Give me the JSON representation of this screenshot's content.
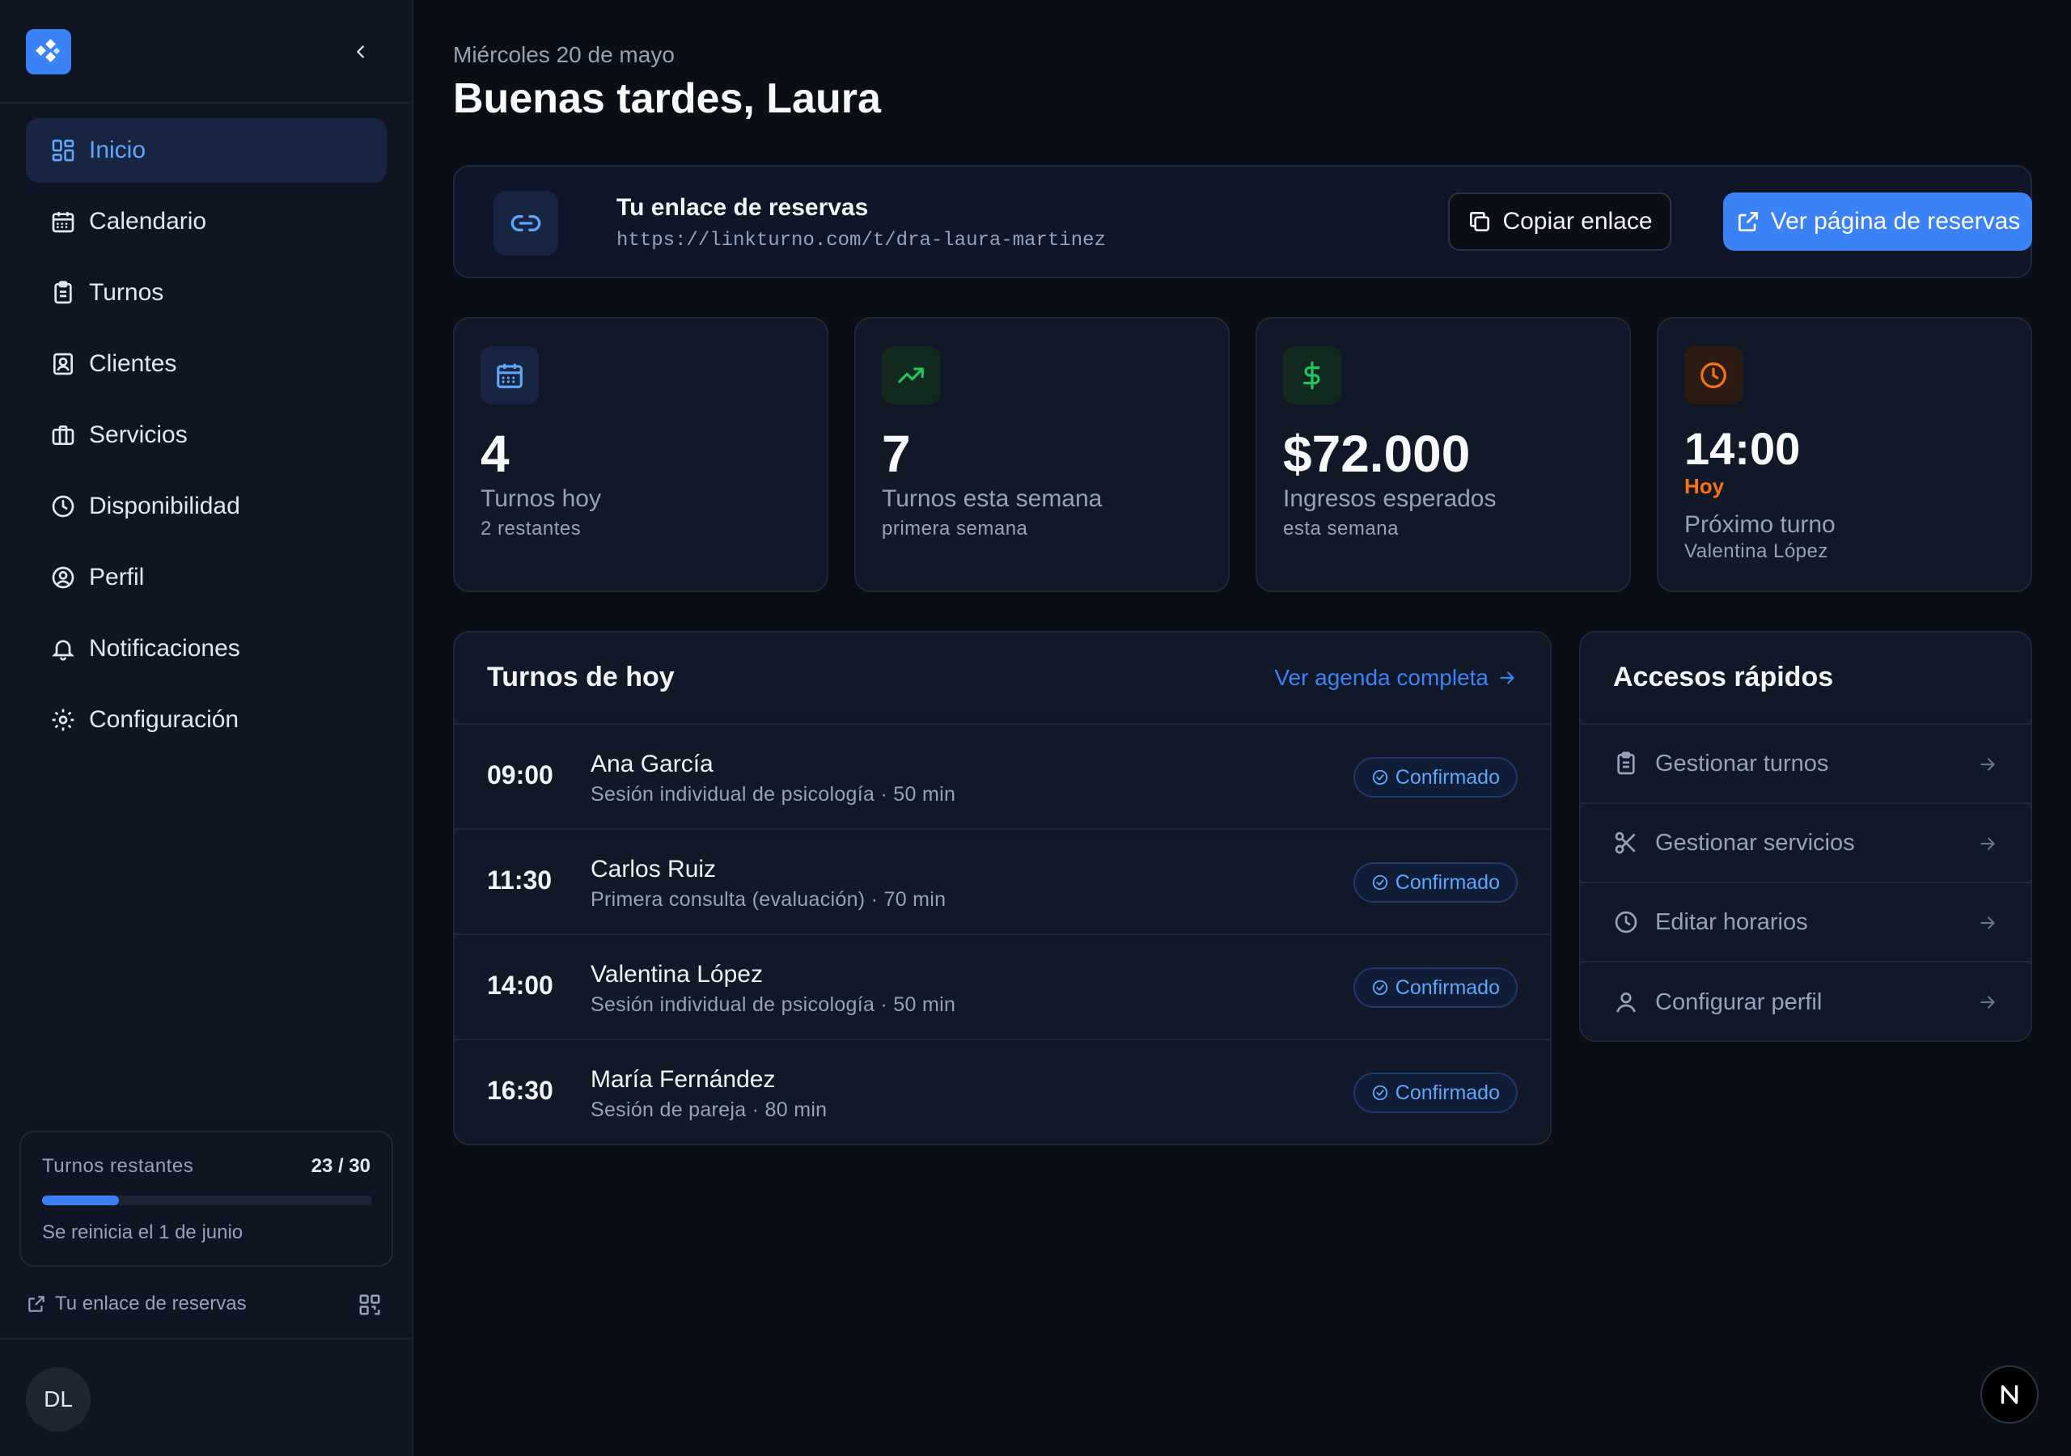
{
  "sidebar": {
    "logo_icon": "app-logo-icon",
    "collapse_icon": "chevron-left-icon",
    "nav": [
      {
        "label": "Inicio",
        "icon": "dashboard-grid-icon",
        "active": true
      },
      {
        "label": "Calendario",
        "icon": "calendar-icon"
      },
      {
        "label": "Turnos",
        "icon": "clipboard-icon"
      },
      {
        "label": "Clientes",
        "icon": "contact-card-icon"
      },
      {
        "label": "Servicios",
        "icon": "briefcase-icon"
      },
      {
        "label": "Disponibilidad",
        "icon": "clock-icon"
      },
      {
        "label": "Perfil",
        "icon": "user-circle-icon"
      },
      {
        "label": "Notificaciones",
        "icon": "bell-icon"
      },
      {
        "label": "Configuración",
        "icon": "gear-icon"
      }
    ],
    "quota": {
      "label": "Turnos restantes",
      "count": "23 / 30",
      "used_fraction": 0.233,
      "reset": "Se reinicia el 1 de junio"
    },
    "booking_link": "Tu enlace de reservas",
    "avatar": "DL"
  },
  "main": {
    "date": "Miércoles 20 de mayo",
    "greeting": "Buenas tardes, Laura",
    "booking": {
      "title": "Tu enlace de reservas",
      "url": "https://linkturno.com/t/dra-laura-martinez",
      "copy_label": "Copiar enlace",
      "view_label": "Ver página de reservas"
    },
    "stats": [
      {
        "icon": "calendar-icon",
        "value": "4",
        "label": "Turnos hoy",
        "sub": "2 restantes"
      },
      {
        "icon": "trending-up-icon",
        "value": "7",
        "label": "Turnos esta semana",
        "sub": "primera semana"
      },
      {
        "icon": "dollar-icon",
        "value": "$72.000",
        "label": "Ingresos esperados",
        "sub": "esta semana"
      },
      {
        "icon": "clock-icon",
        "value": "14:00",
        "tag": "Hoy",
        "label": "Próximo turno",
        "sub": "Valentina López"
      }
    ],
    "today": {
      "title": "Turnos de hoy",
      "link": "Ver agenda completa",
      "appointments": [
        {
          "time": "09:00",
          "name": "Ana García",
          "service": "Sesión individual de psicología · 50 min",
          "status": "Confirmado"
        },
        {
          "time": "11:30",
          "name": "Carlos Ruiz",
          "service": "Primera consulta (evaluación) · 70 min",
          "status": "Confirmado"
        },
        {
          "time": "14:00",
          "name": "Valentina López",
          "service": "Sesión individual de psicología · 50 min",
          "status": "Confirmado"
        },
        {
          "time": "16:30",
          "name": "María Fernández",
          "service": "Sesión de pareja · 80 min",
          "status": "Confirmado"
        }
      ]
    },
    "quick": {
      "title": "Accesos rápidos",
      "items": [
        {
          "label": "Gestionar turnos",
          "icon": "clipboard-icon"
        },
        {
          "label": "Gestionar servicios",
          "icon": "scissors-icon"
        },
        {
          "label": "Editar horarios",
          "icon": "clock-icon"
        },
        {
          "label": "Configurar perfil",
          "icon": "user-icon"
        }
      ]
    }
  },
  "colors": {
    "accent": "#3b82f6",
    "accent_light": "#60a5fa",
    "success": "#22c55e",
    "warning": "#f97316",
    "background": "#0a0e17",
    "sidebar": "#0f1523",
    "card": "#111827"
  }
}
